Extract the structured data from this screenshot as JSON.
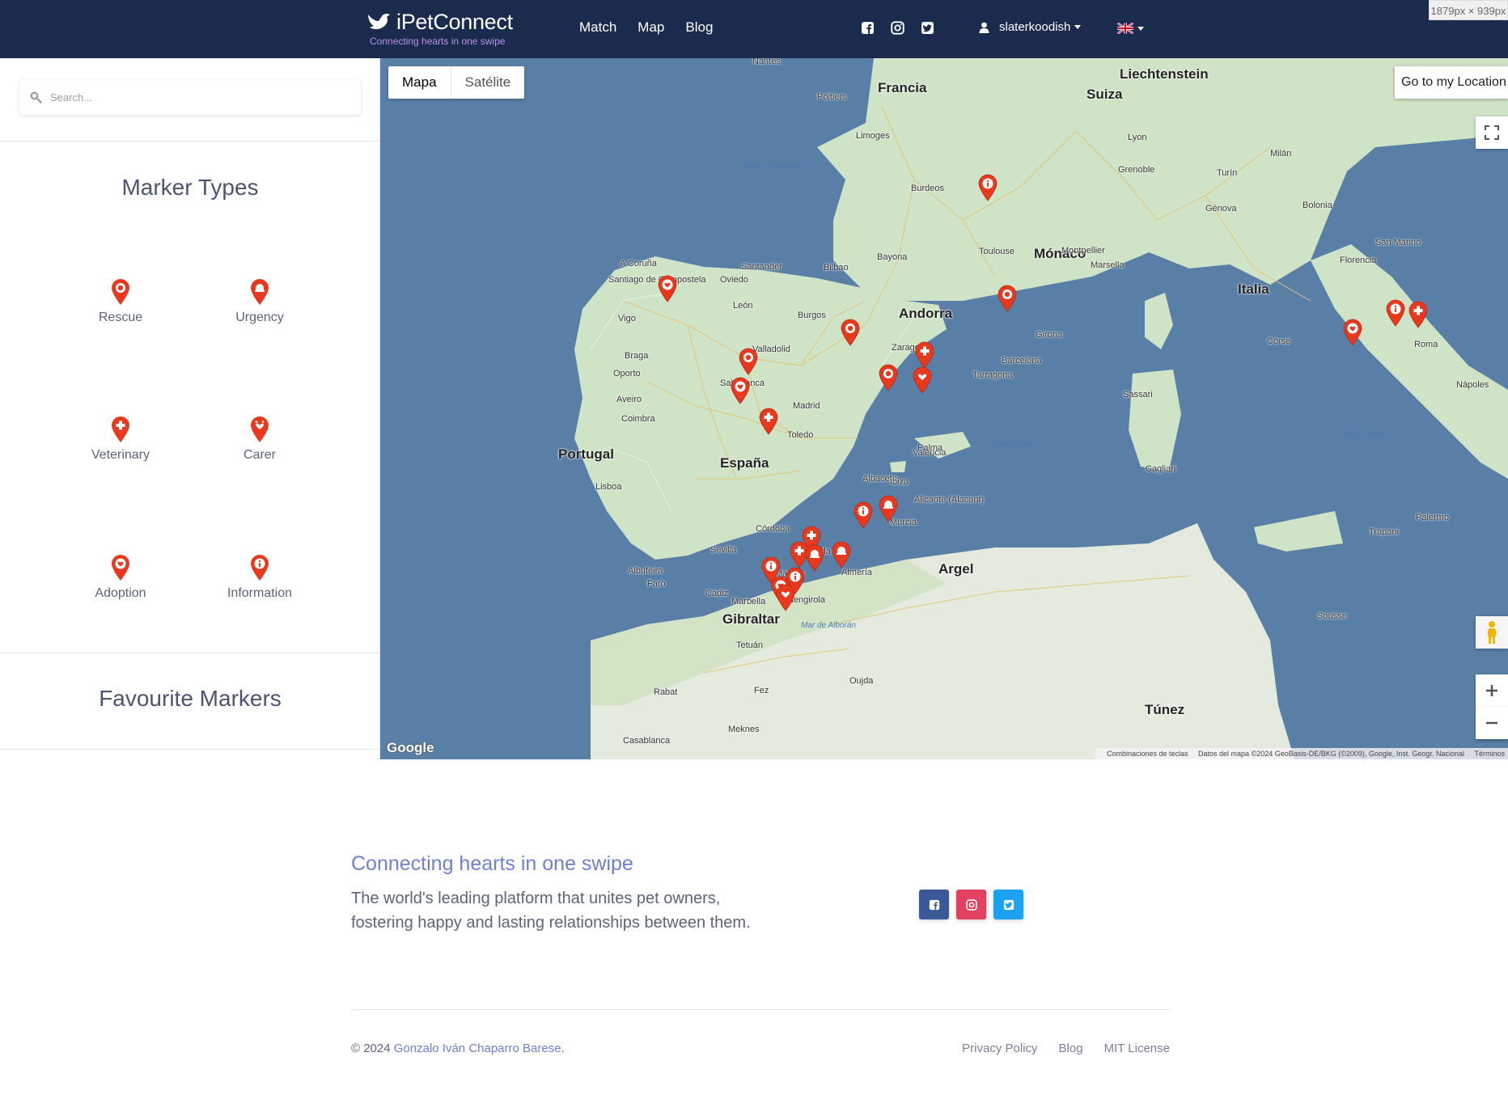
{
  "navbar": {
    "brand_name": "iPetConnect",
    "brand_tagline": "Connecting hearts in one swipe",
    "links": [
      "Match",
      "Map",
      "Blog"
    ],
    "social": [
      "facebook-icon",
      "instagram-icon",
      "twitter-icon"
    ],
    "user": "slaterkoodish",
    "language_flag": "uk-flag-icon",
    "size_badge": "1879px × 939px"
  },
  "sidebar": {
    "search_placeholder": "Search...",
    "marker_types_title": "Marker Types",
    "marker_types": [
      "Rescue",
      "Urgency",
      "Veterinary",
      "Carer",
      "Adoption",
      "Information"
    ],
    "favourites_title": "Favourite Markers"
  },
  "map": {
    "type_buttons": [
      "Mapa",
      "Satélite"
    ],
    "location_button": "Go to my Location",
    "google_logo": "Google",
    "attribution": [
      "Combinaciones de teclas",
      "Datos del mapa ©2024 GeoBasis-DE/BKG (©2009), Google, Inst. Geogr. Nacional",
      "Términos"
    ],
    "labels": {
      "countries": [
        "Francia",
        "España",
        "Portugal",
        "Italia",
        "Suiza",
        "Andorra",
        "Liechtenstein",
        "Mónaco",
        "Argel",
        "Túnez",
        "Gibraltar"
      ],
      "cities": [
        "Nantes",
        "Poitiers",
        "Limoges",
        "Burdeos",
        "Toulouse",
        "Montpellier",
        "Marsella",
        "Bayona",
        "Bilbao",
        "Santander",
        "Oviedo",
        "León",
        "Burgos",
        "Valladolid",
        "Salamanca",
        "Madrid",
        "Toledo",
        "Zaragoza",
        "Barcelona",
        "Tarragona",
        "Girona",
        "Valencia",
        "Albacete",
        "Alicante (Alacant)",
        "Murcia",
        "Córdoba",
        "Sevilla",
        "Granada",
        "Almería",
        "Málaga",
        "Fuengirola",
        "Marbella",
        "Cádiz",
        "Faro",
        "Albufeira",
        "Lisboa",
        "Coimbra",
        "Aveiro",
        "Oporto",
        "Braga",
        "Vigo",
        "A Coruña",
        "Santiago de Compostela",
        "Lyon",
        "Grenoble",
        "Génova",
        "Turín",
        "Milán",
        "Bolonia",
        "Florencia",
        "San Marino",
        "Roma",
        "Nápoles",
        "Palma",
        "Ibiza",
        "Sassari",
        "Cagliari",
        "Corse",
        "Palermo",
        "Trapani",
        "Fez",
        "Rabat",
        "Casablanca",
        "Tetuán",
        "Oujda",
        "Meknes",
        "Sousse"
      ],
      "seas": [
        "Golfo de Vizcaya",
        "Mar Balear",
        "Mar de Alborán",
        "Mar Tirreno"
      ]
    },
    "markers": [
      {
        "type": "information",
        "icon": "information"
      },
      {
        "type": "adoption",
        "icon": "adoption"
      },
      {
        "type": "rescue",
        "icon": "rescue"
      },
      {
        "type": "rescue",
        "icon": "rescue"
      },
      {
        "type": "adoption",
        "icon": "adoption"
      },
      {
        "type": "veterinary",
        "icon": "veterinary"
      },
      {
        "type": "rescue",
        "icon": "rescue"
      },
      {
        "type": "rescue",
        "icon": "rescue"
      },
      {
        "type": "veterinary",
        "icon": "veterinary"
      },
      {
        "type": "carer",
        "icon": "carer"
      },
      {
        "type": "adoption",
        "icon": "adoption"
      },
      {
        "type": "information",
        "icon": "information"
      },
      {
        "type": "veterinary",
        "icon": "veterinary"
      },
      {
        "type": "information",
        "icon": "information"
      },
      {
        "type": "urgency",
        "icon": "urgency"
      },
      {
        "type": "veterinary",
        "icon": "veterinary"
      },
      {
        "type": "veterinary",
        "icon": "veterinary"
      },
      {
        "type": "urgency",
        "icon": "urgency"
      },
      {
        "type": "urgency",
        "icon": "urgency"
      },
      {
        "type": "information",
        "icon": "information"
      },
      {
        "type": "adoption",
        "icon": "adoption"
      },
      {
        "type": "information",
        "icon": "information"
      },
      {
        "type": "carer",
        "icon": "carer"
      }
    ]
  },
  "footer": {
    "tagline": "Connecting hearts in one swipe",
    "description": "The world's leading platform that unites pet owners, fostering happy and lasting relationships between them.",
    "social": [
      "facebook-icon",
      "instagram-icon",
      "twitter-icon"
    ],
    "copyright_prefix": "© 2024",
    "author": "Gonzalo Iván Chaparro Barese",
    "copyright_suffix": ".",
    "links": [
      "Privacy Policy",
      "Blog",
      "MIT License"
    ]
  },
  "colors": {
    "navbar": "#1b2b4e",
    "accent": "#6f7fd2",
    "marker": "#e8391f",
    "facebook": "#3b5998",
    "instagram": "#e4405f",
    "twitter": "#1da1f2",
    "sea": "#5a7fa6",
    "land": "#cfe3c6"
  }
}
